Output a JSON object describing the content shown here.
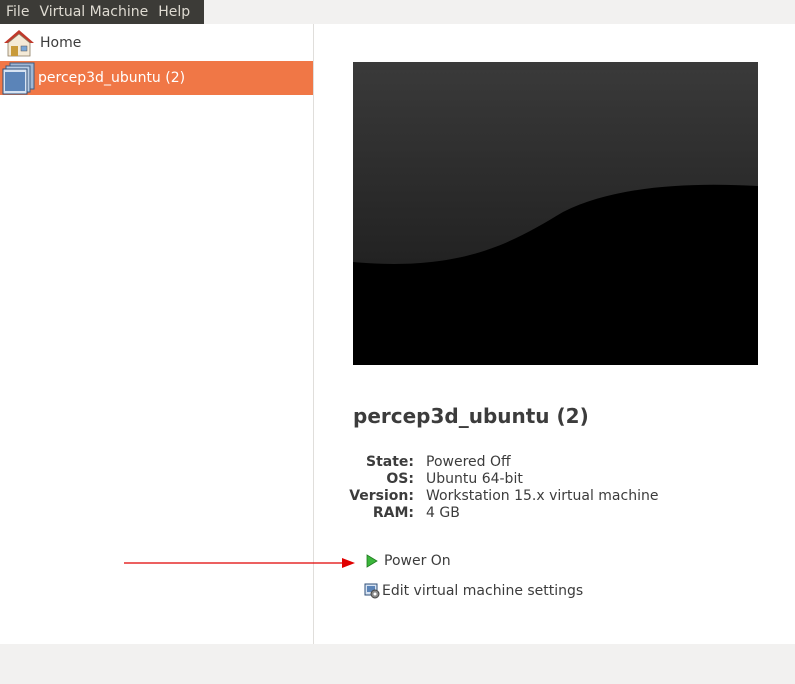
{
  "menubar": {
    "items": [
      "File",
      "Virtual Machine",
      "Help"
    ]
  },
  "sidebar": {
    "items": [
      {
        "label": "Home",
        "icon": "home-icon"
      },
      {
        "label": "percep3d_ubuntu (2)",
        "icon": "vm-icon",
        "selected": true
      }
    ]
  },
  "vm": {
    "name": "percep3d_ubuntu (2)",
    "details": [
      {
        "key": "State:",
        "value": "Powered Off"
      },
      {
        "key": "OS:",
        "value": "Ubuntu 64-bit"
      },
      {
        "key": "Version:",
        "value": "Workstation 15.x virtual machine"
      },
      {
        "key": "RAM:",
        "value": "4 GB"
      }
    ]
  },
  "actions": {
    "power_on": "Power On",
    "edit_settings": "Edit virtual machine settings"
  },
  "colors": {
    "selection": "#f07746",
    "menubar": "#3c3b37",
    "arrow": "#e00000",
    "play": "#3bb63b"
  }
}
